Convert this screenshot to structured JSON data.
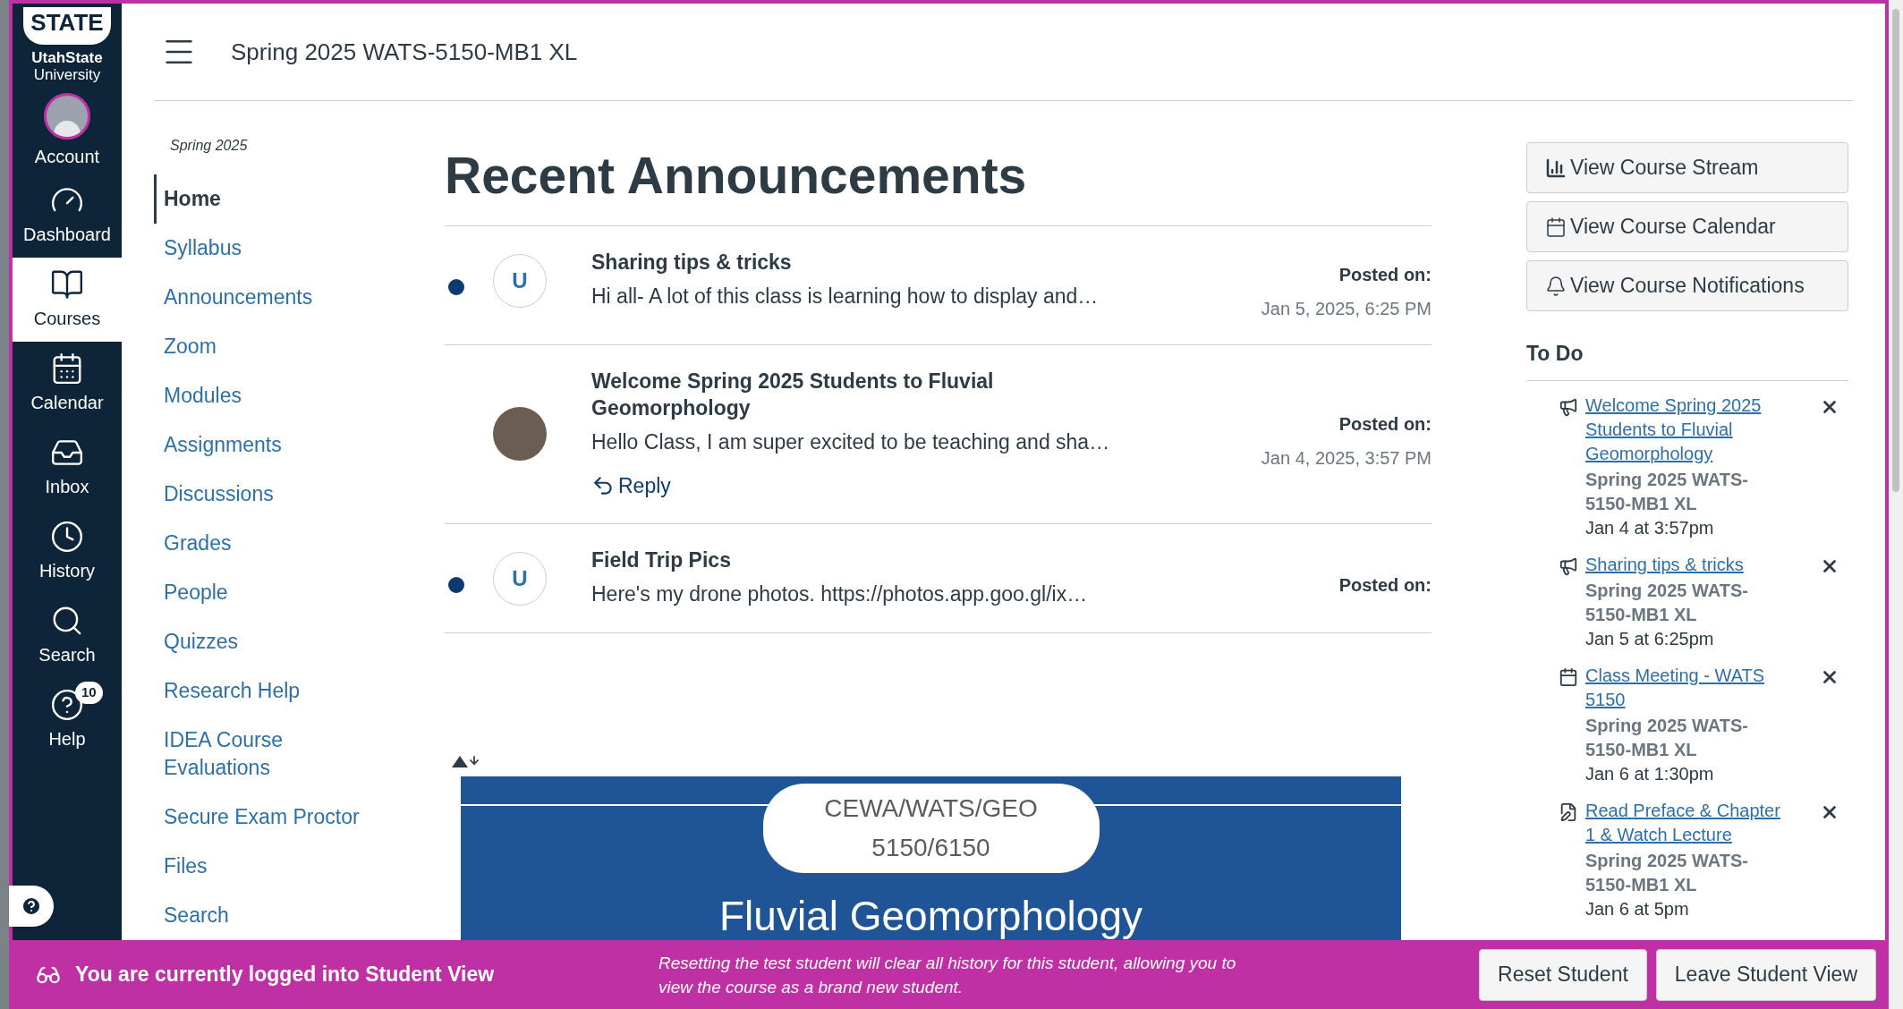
{
  "global_nav": {
    "logo": {
      "mark": "STATE",
      "name": "UtahState",
      "sub": "University"
    },
    "items": [
      {
        "label": "Account",
        "selected": false
      },
      {
        "label": "Dashboard",
        "selected": false
      },
      {
        "label": "Courses",
        "selected": true
      },
      {
        "label": "Calendar",
        "selected": false
      },
      {
        "label": "Inbox",
        "selected": false
      },
      {
        "label": "History",
        "selected": false
      },
      {
        "label": "Search",
        "selected": false
      },
      {
        "label": "Help",
        "selected": false,
        "badge": "10"
      }
    ]
  },
  "header": {
    "title": "Spring 2025 WATS-5150-MB1 XL"
  },
  "course_nav": {
    "term": "Spring 2025",
    "items": [
      {
        "label": "Home",
        "selected": true
      },
      {
        "label": "Syllabus",
        "selected": false
      },
      {
        "label": "Announcements",
        "selected": false
      },
      {
        "label": "Zoom",
        "selected": false
      },
      {
        "label": "Modules",
        "selected": false
      },
      {
        "label": "Assignments",
        "selected": false
      },
      {
        "label": "Discussions",
        "selected": false
      },
      {
        "label": "Grades",
        "selected": false
      },
      {
        "label": "People",
        "selected": false
      },
      {
        "label": "Quizzes",
        "selected": false
      },
      {
        "label": "Research Help",
        "selected": false
      },
      {
        "label": "IDEA Course Evaluations",
        "selected": false
      },
      {
        "label": "Secure Exam Proctor",
        "selected": false
      },
      {
        "label": "Files",
        "selected": false
      },
      {
        "label": "Search",
        "selected": false
      }
    ]
  },
  "announcements": {
    "title": "Recent Announcements",
    "items": [
      {
        "title": "Sharing tips & tricks",
        "excerpt": "Hi all- A lot of this class is learning how to display and…",
        "unread": true,
        "avatar": {
          "kind": "letter",
          "letter": "U"
        },
        "posted_label": "Posted on:",
        "posted_date": "Jan 5, 2025, 6:25 PM"
      },
      {
        "title": "Welcome Spring 2025 Students to Fluvial Geomorphology",
        "excerpt": "Hello Class, I am super excited to be teaching and sha…",
        "unread": false,
        "avatar": {
          "kind": "photo"
        },
        "posted_label": "Posted on:",
        "posted_date": "Jan 4, 2025, 3:57 PM",
        "reply": "Reply"
      },
      {
        "title": "Field Trip Pics",
        "excerpt": "Here's my drone photos. https://photos.app.goo.gl/ix…",
        "unread": true,
        "avatar": {
          "kind": "letter",
          "letter": "U"
        },
        "posted_label": "Posted on:"
      }
    ]
  },
  "banner": {
    "pill_lines": [
      "CEWA/WATS/GEO",
      "5150/6150"
    ],
    "title": "Fluvial Geomorphology"
  },
  "sidebar": {
    "buttons": [
      "View Course Stream",
      "View Course Calendar",
      "View Course Notifications"
    ],
    "todo": {
      "title": "To Do",
      "items": [
        {
          "kind": "announcement",
          "title": "Welcome Spring 2025 Students to Fluvial Geomorphology",
          "course": "Spring 2025 WATS-5150-MB1 XL",
          "due": "Jan 4 at 3:57pm"
        },
        {
          "kind": "announcement",
          "title": "Sharing tips & tricks",
          "course": "Spring 2025 WATS-5150-MB1 XL",
          "due": "Jan 5 at 6:25pm"
        },
        {
          "kind": "event",
          "title": "Class Meeting - WATS 5150",
          "course": "Spring 2025 WATS-5150-MB1 XL",
          "due": "Jan 6 at 1:30pm"
        },
        {
          "kind": "assignment",
          "title": "Read Preface & Chapter 1 & Watch Lecture",
          "course": "Spring 2025 WATS-5150-MB1 XL",
          "due": "Jan 6 at 5pm"
        }
      ]
    }
  },
  "student_view": {
    "message": "You are currently logged into Student View",
    "note": "Resetting the test student will clear all history for this student, allowing you to view the course as a brand new student.",
    "buttons": [
      "Reset Student",
      "Leave Student View"
    ]
  }
}
